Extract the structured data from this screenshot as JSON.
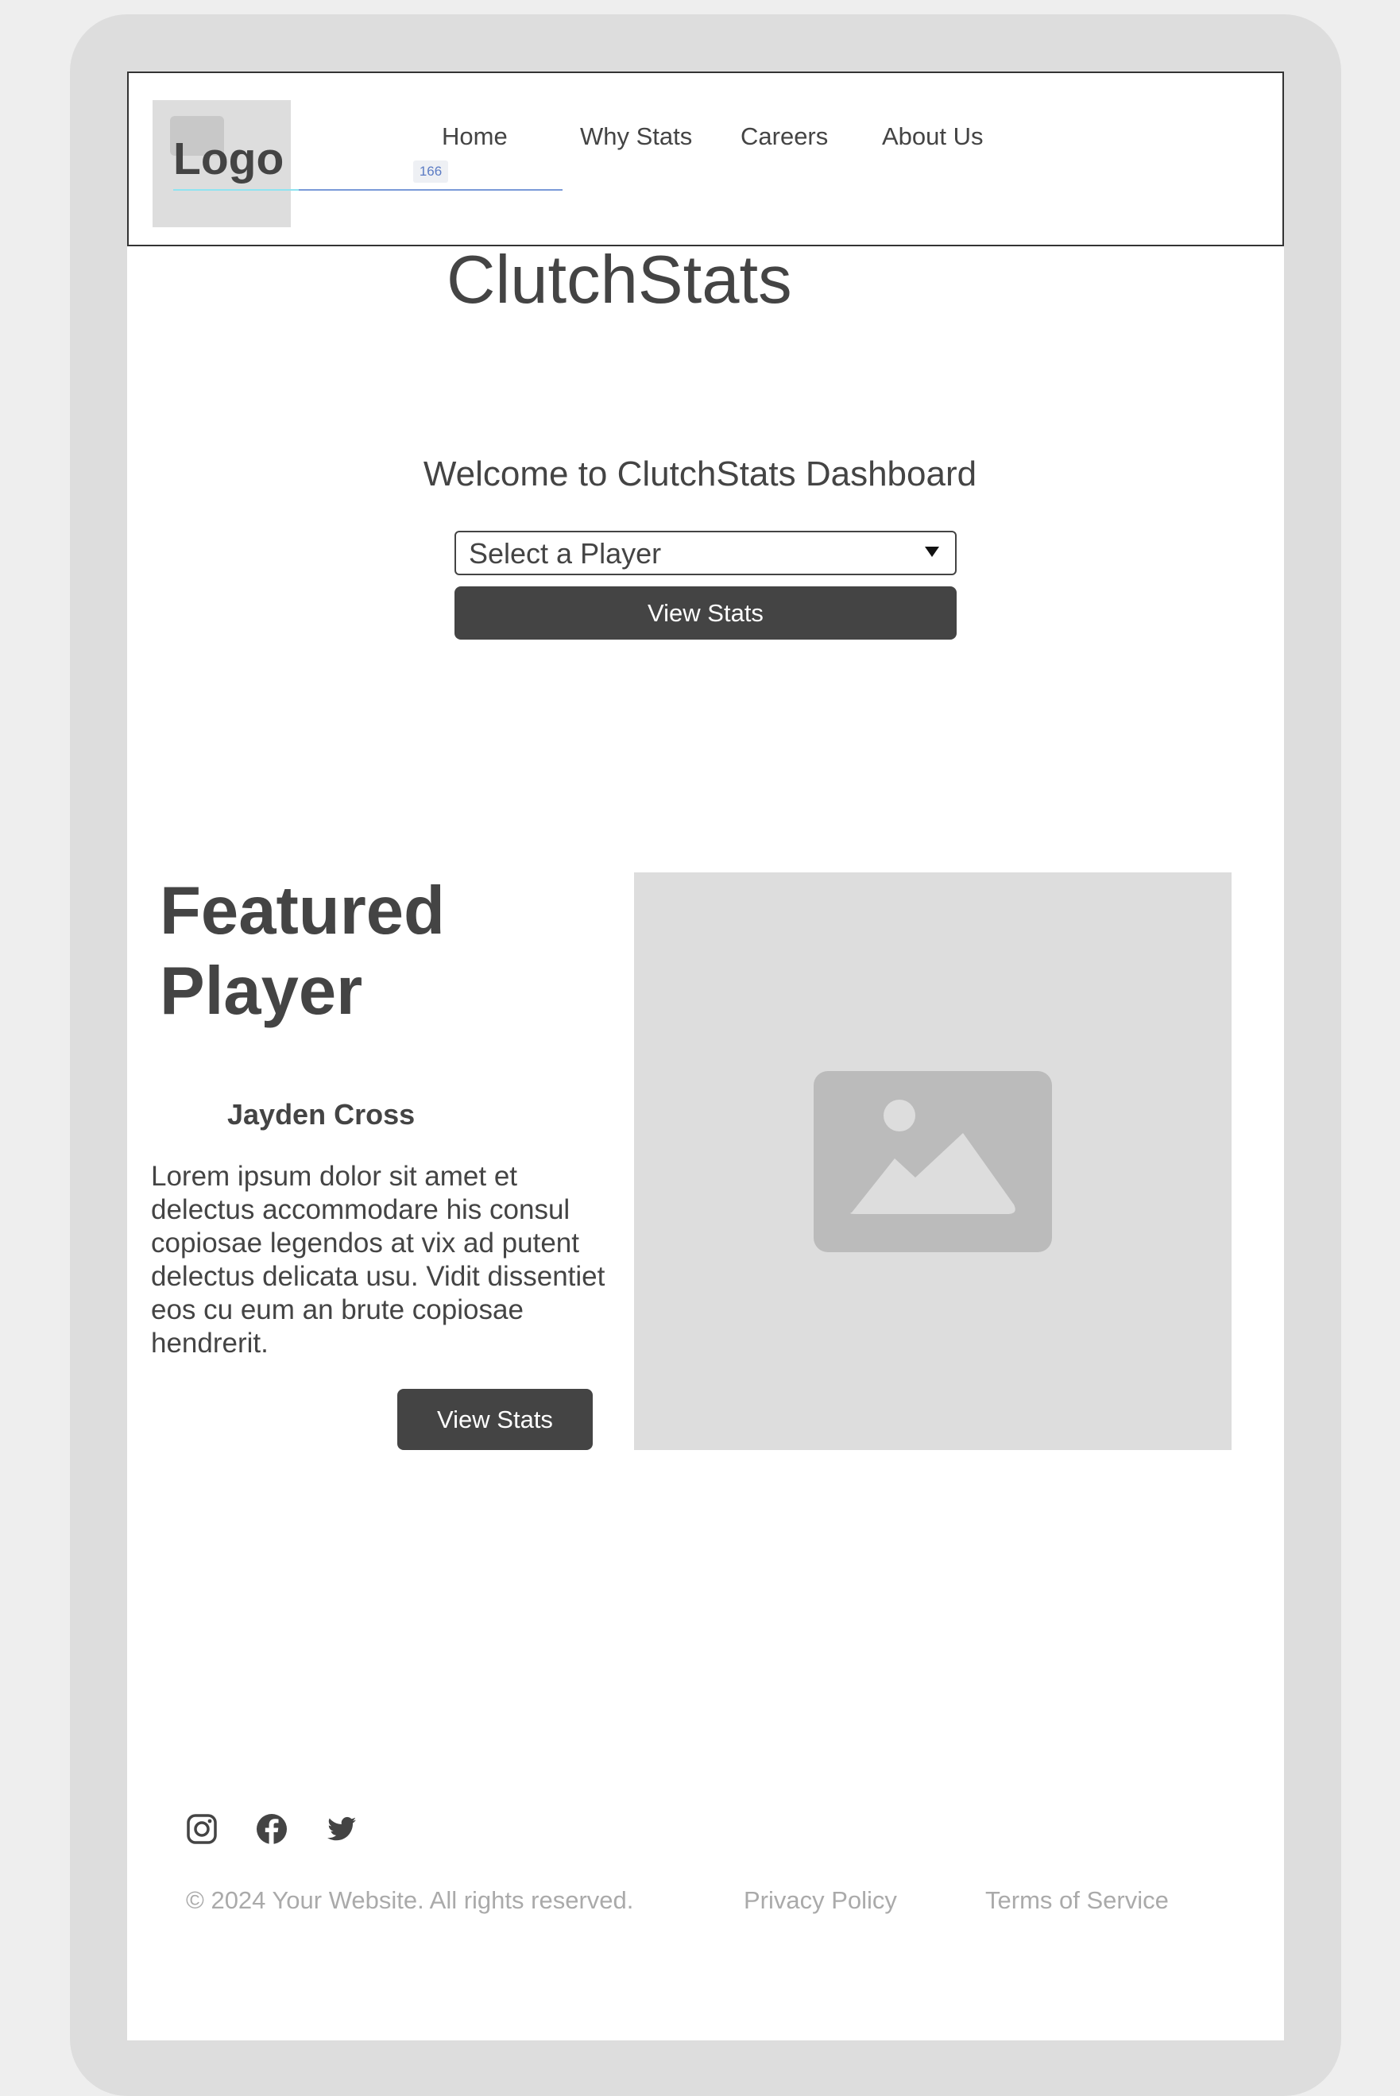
{
  "header": {
    "logo": "Logo",
    "guide_badge": "166",
    "nav": [
      "Home",
      "Why Stats",
      "Careers",
      "About Us"
    ]
  },
  "hero": {
    "site_title": "ClutchStats",
    "welcome": "Welcome to ClutchStats Dashboard",
    "select_placeholder": "Select a Player",
    "button_label": "View Stats"
  },
  "featured": {
    "heading": "Featured Player",
    "player_name": "Jayden Cross",
    "bio": "Lorem ipsum dolor sit amet et delectus accommodare his consul copiosae legendos at vix ad putent delectus delicata usu. Vidit dissentiet eos cu eum an brute copiosae hendrerit.",
    "button_label": "View Stats",
    "image_icon": "image-placeholder-icon"
  },
  "footer": {
    "social_icons": [
      "instagram-icon",
      "facebook-icon",
      "twitter-icon"
    ],
    "copyright": "© 2024 Your Website. All rights reserved.",
    "privacy": "Privacy Policy",
    "terms": "Terms of Service"
  },
  "colors": {
    "primary_dark": "#444444",
    "placeholder_gray": "#dddddd",
    "footer_text": "#aaaaaa",
    "frame_gray": "#dddddd"
  }
}
